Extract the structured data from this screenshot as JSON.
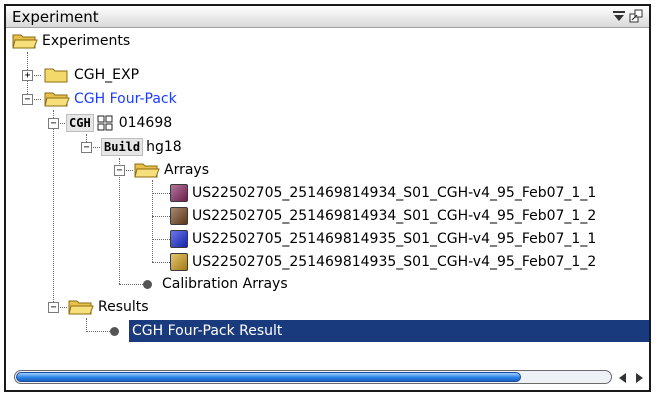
{
  "window": {
    "title": "Experiment"
  },
  "tree": {
    "root": {
      "label": "Experiments"
    },
    "cgh_exp": {
      "label": "CGH_EXP",
      "expander": "+"
    },
    "four_pack": {
      "label": "CGH Four-Pack",
      "expander": "−"
    },
    "cgh_node": {
      "badge": "CGH",
      "label": "014698",
      "expander": "−"
    },
    "build_node": {
      "badge": "Build",
      "label": "hg18",
      "expander": "−"
    },
    "arrays_folder": {
      "label": "Arrays",
      "expander": "−"
    },
    "arrays": [
      {
        "label": "US22502705_251469814934_S01_CGH-v4_95_Feb07_1_1",
        "color": "#8e2b66"
      },
      {
        "label": "US22502705_251469814934_S01_CGH-v4_95_Feb07_1_2",
        "color": "#7a4a23"
      },
      {
        "label": "US22502705_251469814935_S01_CGH-v4_95_Feb07_1_1",
        "color": "#1c2fe0"
      },
      {
        "label": "US22502705_251469814935_S01_CGH-v4_95_Feb07_1_2",
        "color": "#d9a520"
      }
    ],
    "calibration": {
      "label": "Calibration Arrays"
    },
    "results_folder": {
      "label": "Results",
      "expander": "−"
    },
    "result_item": {
      "label": "CGH Four-Pack Result",
      "selected": true
    }
  },
  "colors": {
    "selection": "#1a3a7e",
    "link_text": "#1d3cff",
    "folder": "#f3d96a"
  },
  "scroll": {
    "position_fraction": 0.0,
    "visible_fraction": 0.85
  }
}
